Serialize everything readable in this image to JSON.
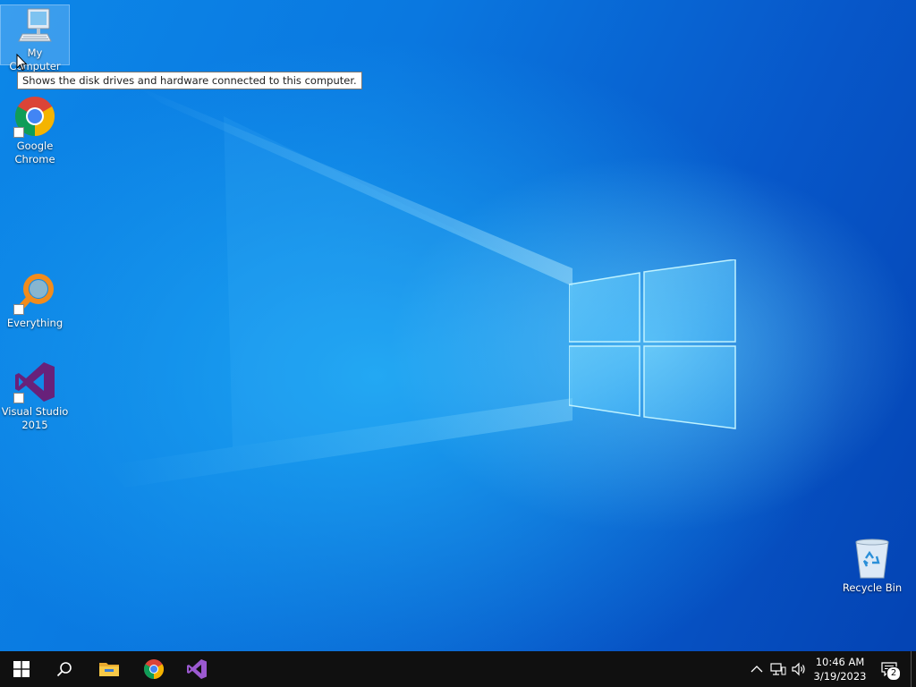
{
  "desktop": {
    "icons": [
      {
        "label": "My Computer",
        "icon": "computer-icon"
      },
      {
        "label": "Google\nChrome",
        "icon": "chrome-icon"
      },
      {
        "label": "Everything",
        "icon": "everything-search-icon"
      },
      {
        "label": "Visual Studio\n2015",
        "icon": "visual-studio-icon"
      },
      {
        "label": "Recycle Bin",
        "icon": "recycle-bin-icon"
      }
    ],
    "tooltip": "Shows the disk drives and hardware connected to this computer."
  },
  "taskbar": {
    "apps": [
      {
        "name": "Start",
        "icon": "windows-start-icon"
      },
      {
        "name": "Search",
        "icon": "search-icon"
      },
      {
        "name": "File Explorer",
        "icon": "folder-icon"
      },
      {
        "name": "Google Chrome",
        "icon": "chrome-icon"
      },
      {
        "name": "Visual Studio",
        "icon": "visual-studio-icon"
      }
    ],
    "clock": {
      "time": "10:46 AM",
      "date": "3/19/2023"
    },
    "notifications_count": "2"
  },
  "colors": {
    "desktop_blue": "#0a78e0",
    "taskbar": "#101010",
    "chrome_red": "#db4437",
    "chrome_green": "#0f9d58",
    "chrome_yellow": "#f4b400",
    "chrome_blue": "#4285f4",
    "vs_purple": "#68217a",
    "everything_orange": "#f28c1c"
  }
}
